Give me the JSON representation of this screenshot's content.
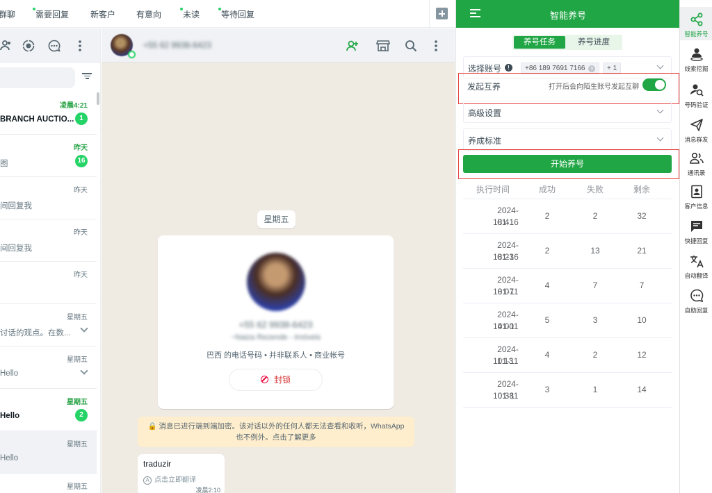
{
  "top_tabs": [
    {
      "label": "群聊",
      "dot": false
    },
    {
      "label": "需要回复",
      "dot": true
    },
    {
      "label": "新客户",
      "dot": false
    },
    {
      "label": "有意向",
      "dot": false
    },
    {
      "label": "未读",
      "dot": true
    },
    {
      "label": "等待回复",
      "dot": true
    }
  ],
  "chat_list": {
    "rows": [
      {
        "time": "凌晨4:21",
        "snippet": "BRANCH AUCTIO...",
        "badge": "1",
        "unread": true,
        "bold": true
      },
      {
        "time": "昨天",
        "snippet": "图",
        "badge": "16",
        "unread": true,
        "bold": false
      },
      {
        "time": "昨天",
        "snippet": "间回复我",
        "badge": "",
        "unread": false,
        "bold": false
      },
      {
        "time": "昨天",
        "snippet": "间回复我",
        "badge": "",
        "unread": false,
        "bold": false
      },
      {
        "time": "昨天",
        "snippet": "",
        "badge": "",
        "unread": false,
        "bold": false
      },
      {
        "time": "星期五",
        "snippet": "讨话的观点。在数...",
        "badge": "",
        "unread": false,
        "bold": false,
        "chevron": true
      },
      {
        "time": "星期五",
        "snippet": "Hello",
        "badge": "",
        "unread": false,
        "bold": false,
        "chevron": true
      },
      {
        "time": "星期五",
        "snippet": "Hello",
        "badge": "2",
        "unread": true,
        "bold": true
      },
      {
        "time": "星期五",
        "snippet": "Hello",
        "badge": "",
        "unread": false,
        "bold": false,
        "selected": true
      },
      {
        "time": "星期五",
        "snippet": "",
        "badge": "",
        "unread": false,
        "bold": false
      }
    ]
  },
  "conversation": {
    "phone": "+55 62 9938-6423",
    "day_chip": "星期五",
    "card": {
      "phone": "+55 62 9938-6423",
      "name": "~Naiza Rezende - Imóveis",
      "desc": "巴西 的电话号码 • 并非联系人 • 商业帐号",
      "block_label": "封锁"
    },
    "encrypt_note": "消息已进行端到端加密。该对话以外的任何人都无法查看和收听，WhatsApp 也不例外。点击了解更多",
    "message": {
      "text": "traduzir",
      "translate": "点击立即翻译",
      "time": "凌晨2:10"
    }
  },
  "assistant": {
    "title": "智能养号",
    "tabs": {
      "active": "养号任务",
      "inactive": "养号进度"
    },
    "account_label": "选择账号",
    "account_tag": "+86 189 7691 7166",
    "account_more": "+ 1",
    "mutual_label": "发起互养",
    "mutual_hint": "打开后会向陌生账号发起互聊",
    "advanced_label": "高级设置",
    "standard_label": "养成标准",
    "start_button": "开始养号",
    "table_headers": [
      "执行时间",
      "成功",
      "失败",
      "剩余"
    ],
    "tasks": [
      {
        "date": "2024-01-16",
        "time": "18:41",
        "success": "2",
        "fail": "2",
        "remain": "32"
      },
      {
        "date": "2024-01-16",
        "time": "18:23",
        "success": "2",
        "fail": "13",
        "remain": "21"
      },
      {
        "date": "2024-01-11",
        "time": "18:07",
        "success": "4",
        "fail": "7",
        "remain": "7"
      },
      {
        "date": "2024-01-11",
        "time": "14:00",
        "success": "5",
        "fail": "3",
        "remain": "10"
      },
      {
        "date": "2024-01-11",
        "time": "11:13",
        "success": "4",
        "fail": "2",
        "remain": "12"
      },
      {
        "date": "2024-01-11",
        "time": "10:38",
        "success": "3",
        "fail": "1",
        "remain": "14"
      }
    ]
  },
  "side_tools": [
    {
      "label": "智能养号",
      "icon": "share-icon",
      "active": true
    },
    {
      "label": "线索挖掘",
      "icon": "user-dig-icon"
    },
    {
      "label": "号码验证",
      "icon": "user-search-icon"
    },
    {
      "label": "消息群发",
      "icon": "send-icon"
    },
    {
      "label": "通讯录",
      "icon": "contacts-icon"
    },
    {
      "label": "客户信息",
      "icon": "id-card-icon"
    },
    {
      "label": "快捷回复",
      "icon": "quick-reply-icon"
    },
    {
      "label": "自动翻译",
      "icon": "translate-icon"
    },
    {
      "label": "自助回复",
      "icon": "auto-reply-icon"
    }
  ],
  "colors": {
    "brand_green": "#21a645",
    "wa_green": "#25d366",
    "highlight_red": "#e53935"
  }
}
